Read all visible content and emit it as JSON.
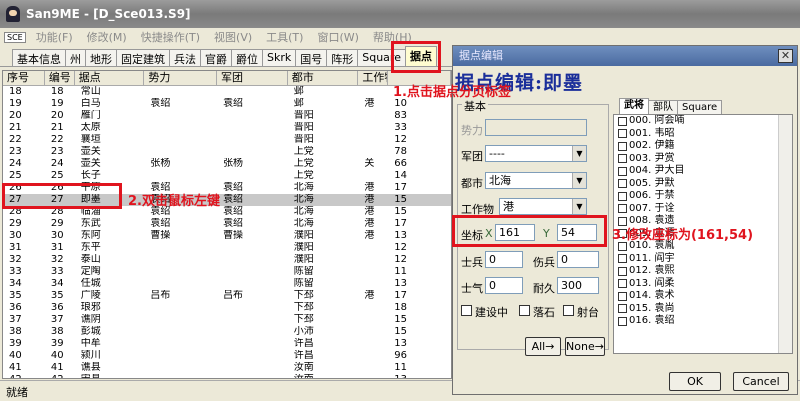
{
  "app": {
    "title": "San9ME - [D_Sce013.S9]"
  },
  "menu": {
    "sys_icon": "SCE",
    "items": [
      "功能(F)",
      "修改(M)",
      "快捷操作(T)",
      "视图(V)",
      "工具(T)",
      "窗口(W)",
      "帮助(H)"
    ]
  },
  "tabs": [
    "基本信息",
    "州",
    "地形",
    "固定建筑",
    "兵法",
    "官爵",
    "爵位",
    "Skrk",
    "国号",
    "阵形",
    "Square",
    "据点"
  ],
  "active_tab": "据点",
  "table": {
    "headers": [
      "序号",
      "编号",
      "据点",
      "势力",
      "军团",
      "都市",
      "工作物",
      ""
    ],
    "rows": [
      [
        "18",
        "18",
        "常山",
        "",
        "",
        "邺",
        "",
        ""
      ],
      [
        "19",
        "19",
        "白马",
        "袁绍",
        "袁绍",
        "邺",
        "港",
        "10"
      ],
      [
        "20",
        "20",
        "雁门",
        "",
        "",
        "晋阳",
        "",
        "83"
      ],
      [
        "21",
        "21",
        "太原",
        "",
        "",
        "晋阳",
        "",
        "33"
      ],
      [
        "22",
        "22",
        "襄垣",
        "",
        "",
        "晋阳",
        "",
        "12"
      ],
      [
        "23",
        "23",
        "壶关",
        "",
        "",
        "上党",
        "",
        "78"
      ],
      [
        "24",
        "24",
        "壶关",
        "张杨",
        "张杨",
        "上党",
        "关",
        "66"
      ],
      [
        "25",
        "25",
        "长子",
        "",
        "",
        "上党",
        "",
        "14"
      ],
      [
        "26",
        "26",
        "平原",
        "袁绍",
        "袁绍",
        "北海",
        "港",
        "17"
      ],
      [
        "27",
        "27",
        "即墨",
        "袁绍",
        "袁绍",
        "北海",
        "港",
        "15"
      ],
      [
        "28",
        "28",
        "临淄",
        "袁绍",
        "袁绍",
        "北海",
        "港",
        "15"
      ],
      [
        "29",
        "29",
        "东武",
        "袁绍",
        "袁绍",
        "北海",
        "港",
        "17"
      ],
      [
        "30",
        "30",
        "东阿",
        "曹操",
        "曹操",
        "濮阳",
        "港",
        "13"
      ],
      [
        "31",
        "31",
        "东平",
        "",
        "",
        "濮阳",
        "",
        "12"
      ],
      [
        "32",
        "32",
        "泰山",
        "",
        "",
        "濮阳",
        "",
        "12"
      ],
      [
        "33",
        "33",
        "定陶",
        "",
        "",
        "陈留",
        "",
        "11"
      ],
      [
        "34",
        "34",
        "任城",
        "",
        "",
        "陈留",
        "",
        "13"
      ],
      [
        "35",
        "35",
        "广陵",
        "吕布",
        "吕布",
        "下邳",
        "港",
        "17"
      ],
      [
        "36",
        "36",
        "琅邪",
        "",
        "",
        "下邳",
        "",
        "18"
      ],
      [
        "37",
        "37",
        "谯阴",
        "",
        "",
        "下邳",
        "",
        "15"
      ],
      [
        "38",
        "38",
        "彭城",
        "",
        "",
        "小沛",
        "",
        "15"
      ],
      [
        "39",
        "39",
        "中牟",
        "",
        "",
        "许昌",
        "",
        "13"
      ],
      [
        "40",
        "40",
        "颍川",
        "",
        "",
        "许昌",
        "",
        "96"
      ],
      [
        "41",
        "41",
        "谯县",
        "",
        "",
        "汝南",
        "",
        "11"
      ],
      [
        "42",
        "42",
        "宋县",
        "",
        "",
        "汝南",
        "",
        "13"
      ],
      [
        "43",
        "43",
        "阳安",
        "",
        "",
        "汝南",
        "",
        "12"
      ]
    ],
    "selected_row": 9
  },
  "status": {
    "text": "就绪"
  },
  "dialog": {
    "title": "据点编辑",
    "heading": "据点编辑:即墨",
    "group_label": "基本",
    "labels": {
      "power": "势力",
      "corps": "军团",
      "city": "都市",
      "work": "工作物",
      "coord": "坐标",
      "x": "X",
      "y": "Y",
      "soldiers": "士兵",
      "wounded": "伤兵",
      "morale": "士气",
      "durability": "耐久"
    },
    "values": {
      "power": "",
      "corps": "----",
      "city": "北海",
      "work": "港",
      "x": "161",
      "y": "54",
      "soldiers": "0",
      "wounded": "0",
      "morale": "0",
      "durability": "300"
    },
    "checks": [
      "建设中",
      "落石",
      "射台"
    ],
    "buttons": {
      "all": "All→",
      "none": "None→",
      "ok": "OK",
      "cancel": "Cancel"
    },
    "right_tabs": [
      "武将",
      "部队",
      "Square"
    ],
    "officers": [
      "000. 阿会喃",
      "001. 韦昭",
      "002. 伊籍",
      "003. 尹赏",
      "004. 尹大目",
      "005. 尹默",
      "006. 于禁",
      "007. 于诠",
      "008. 袁遗",
      "009. 袁谭",
      "010. 袁胤",
      "011. 阎宇",
      "012. 袁熙",
      "013. 阎柔",
      "014. 袁术",
      "015. 袁尚",
      "016. 袁绍"
    ]
  },
  "annotations": {
    "step1": "1.点击据点分页标签",
    "step2": "2.双击鼠标左键",
    "step3": "3.修改座标为(161,54)",
    "color": "#e0141e"
  }
}
